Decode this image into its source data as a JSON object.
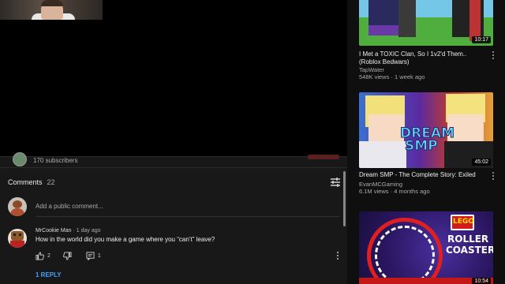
{
  "channel": {
    "subscribers": "170 subscribers"
  },
  "comments": {
    "label": "Comments",
    "count": "22",
    "add_placeholder": "Add a public comment...",
    "items": [
      {
        "author": "MrCookie Man",
        "time": "1 day ago",
        "text": "How in the world did you make a game where you “can’t” leave?",
        "likes": "2",
        "replies": "1",
        "reply_link": "1 REPLY"
      }
    ]
  },
  "related": [
    {
      "title": "I Met a TOXIC Clan, So I 1v2'd Them.. (Roblox Bedwars)",
      "channel": "TapWater",
      "views": "548K views",
      "age": "1 week ago",
      "duration": "10:17"
    },
    {
      "title": "Dream SMP - The Complete Story: Exiled",
      "channel": "EvanMCGaming",
      "views": "6.1M views",
      "age": "4 months ago",
      "duration": "45:02",
      "thumb_text": [
        "DREAM",
        "SMP"
      ]
    },
    {
      "duration": "10:54",
      "thumb_text": [
        "LEGO",
        "ROLLER",
        "COASTER"
      ]
    }
  ],
  "icons": {
    "sort": "sort-icon",
    "like": "thumbs-up-icon",
    "dislike": "thumbs-down-icon",
    "reply": "reply-icon",
    "more": "more-vertical-icon"
  },
  "colors": {
    "link": "#3ea6ff",
    "background": "#181818",
    "sidebar": "#0f0f0f"
  }
}
